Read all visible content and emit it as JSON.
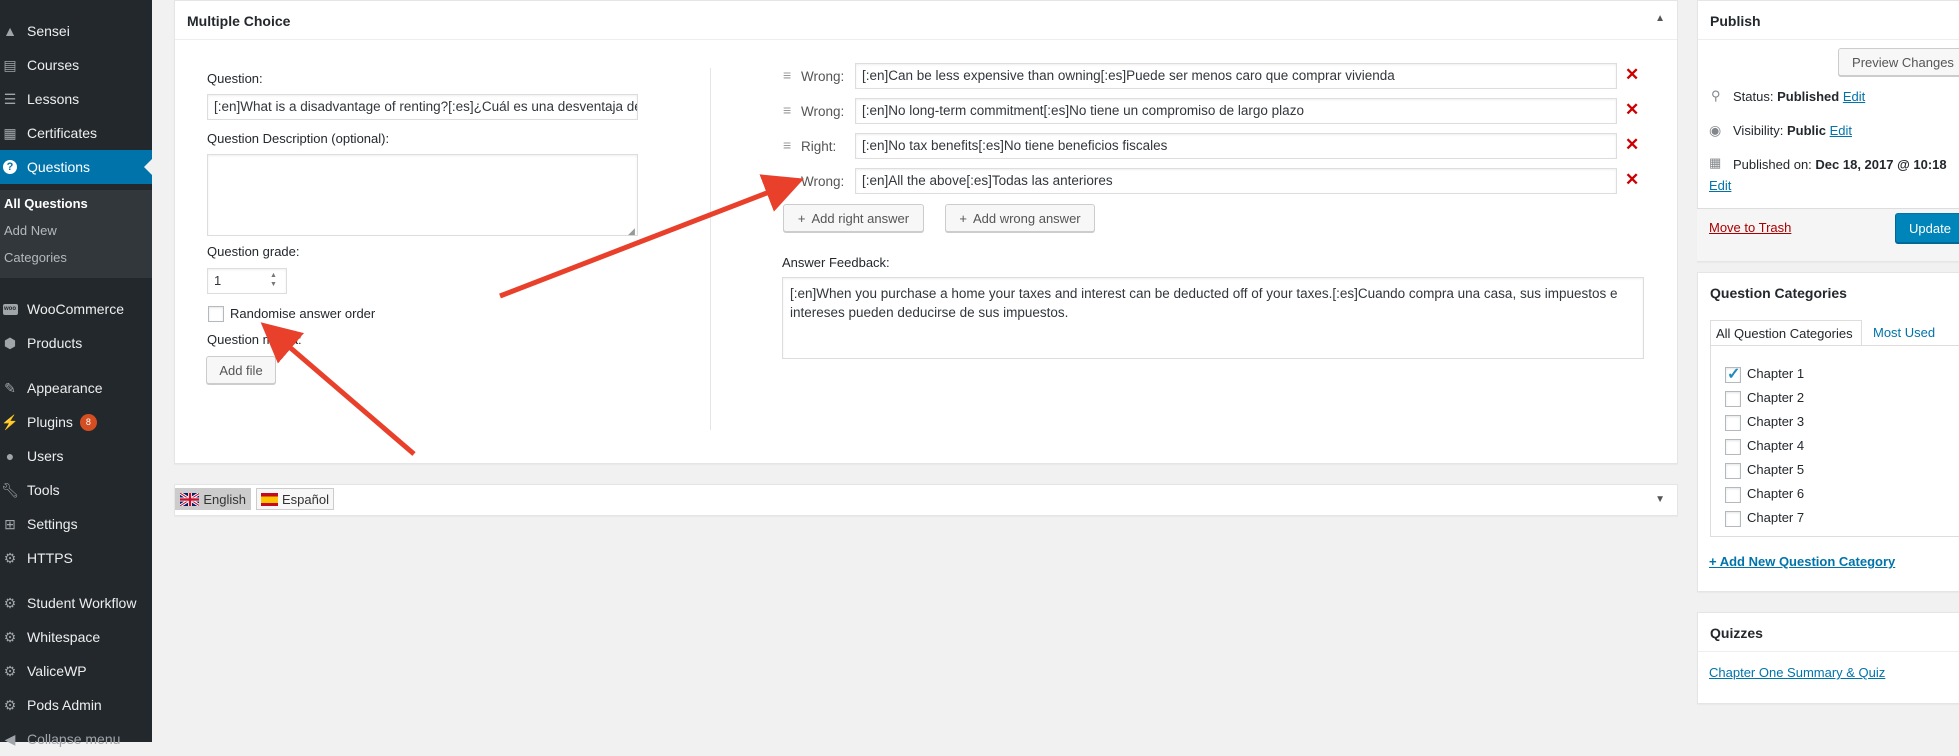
{
  "sidebar": {
    "items": [
      {
        "label": "Sensei",
        "icon": "sensei-icon"
      },
      {
        "label": "Courses",
        "icon": "courses-icon"
      },
      {
        "label": "Lessons",
        "icon": "lessons-icon"
      },
      {
        "label": "Certificates",
        "icon": "certificates-icon"
      },
      {
        "label": "Questions",
        "icon": "question-icon"
      },
      {
        "label": "WooCommerce",
        "icon": "woocommerce-icon"
      },
      {
        "label": "Products",
        "icon": "products-icon"
      },
      {
        "label": "Appearance",
        "icon": "appearance-icon"
      },
      {
        "label": "Plugins",
        "icon": "plugins-icon",
        "badge": "8"
      },
      {
        "label": "Users",
        "icon": "users-icon"
      },
      {
        "label": "Tools",
        "icon": "tools-icon"
      },
      {
        "label": "Settings",
        "icon": "settings-icon"
      },
      {
        "label": "HTTPS",
        "icon": "gear-icon"
      },
      {
        "label": "Student Workflow",
        "icon": "gear-icon"
      },
      {
        "label": "Whitespace",
        "icon": "gear-icon"
      },
      {
        "label": "ValiceWP",
        "icon": "gear-icon"
      },
      {
        "label": "Pods Admin",
        "icon": "gear-icon"
      },
      {
        "label": "Collapse menu",
        "icon": "collapse-icon"
      }
    ],
    "submenu": [
      "All Questions",
      "Add New",
      "Categories"
    ]
  },
  "question_box": {
    "title": "Multiple Choice",
    "question_label": "Question:",
    "question_value": "[:en]What is a disadvantage of renting?[:es]¿Cuál es una desventaja de alquilar?",
    "description_label": "Question Description (optional):",
    "description_value": "",
    "grade_label": "Question grade:",
    "grade_value": "1",
    "randomise_label": "Randomise answer order",
    "media_label": "Question media:",
    "add_file_label": "Add file",
    "answers": [
      {
        "type": "Wrong:",
        "value": "[:en]Can be less expensive than owning[:es]Puede ser menos caro que comprar vivienda"
      },
      {
        "type": "Wrong:",
        "value": "[:en]No long-term commitment[:es]No tiene un compromiso de largo plazo"
      },
      {
        "type": "Right:",
        "value": "[:en]No tax benefits[:es]No tiene beneficios fiscales"
      },
      {
        "type": "Wrong:",
        "value": "[:en]All the above[:es]Todas las anteriores"
      }
    ],
    "add_right_label": "Add right answer",
    "add_wrong_label": "Add wrong answer",
    "feedback_label": "Answer Feedback:",
    "feedback_value": "[:en]When you purchase a home your taxes and interest can be deducted off of your taxes.[:es]Cuando compra una casa, sus impuestos e intereses pueden deducirse de sus impuestos."
  },
  "language_bar": {
    "languages": [
      "English",
      "Español"
    ]
  },
  "publish": {
    "title": "Publish",
    "preview_label": "Preview Changes",
    "status_label": "Status:",
    "status_value": "Published",
    "visibility_label": "Visibility:",
    "visibility_value": "Public",
    "published_label": "Published on:",
    "published_value": "Dec 18, 2017 @ 10:18",
    "edit_label": "Edit",
    "trash_label": "Move to Trash",
    "update_label": "Update"
  },
  "categories": {
    "title": "Question Categories",
    "tab_all": "All Question Categories",
    "tab_most": "Most Used",
    "items": [
      "Chapter 1",
      "Chapter 2",
      "Chapter 3",
      "Chapter 4",
      "Chapter 5",
      "Chapter 6",
      "Chapter 7"
    ],
    "checked": [
      true,
      false,
      false,
      false,
      false,
      false,
      false
    ],
    "add_new_label": "+ Add New Question Category"
  },
  "quizzes": {
    "title": "Quizzes",
    "link": "Chapter One Summary & Quiz"
  },
  "colors": {
    "sidebar_bg": "#23282d",
    "accent": "#0073aa",
    "arrow": "#e8402a",
    "remove": "#cc0000"
  }
}
